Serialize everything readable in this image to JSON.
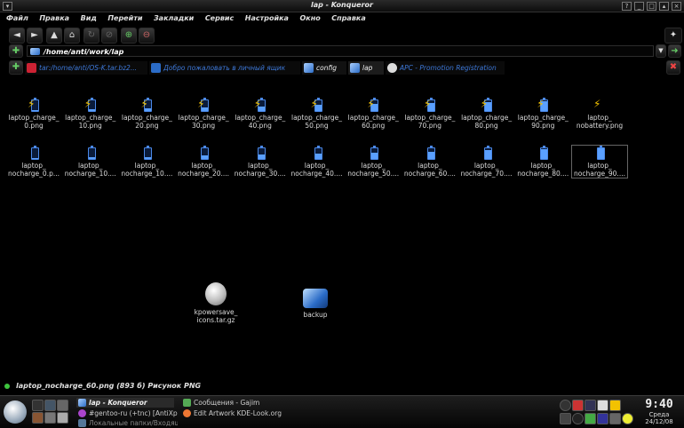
{
  "window": {
    "title": "lap - Konqueror"
  },
  "menubar": {
    "items": [
      "Файл",
      "Правка",
      "Вид",
      "Перейти",
      "Закладки",
      "Сервис",
      "Настройка",
      "Окно",
      "Справка"
    ]
  },
  "location": {
    "path": "/home/anti/work/lap"
  },
  "tabs": [
    {
      "label": "tar:/home/anti/OS-K.tar.bz2...",
      "state": "inactive"
    },
    {
      "label": "Добро пожаловать в личный ящик",
      "state": "inactive"
    },
    {
      "label": "config",
      "state": "active"
    },
    {
      "label": "lap",
      "state": "active"
    },
    {
      "label": "APC - Promotion Registration",
      "state": "inactive"
    }
  ],
  "files_row1": [
    {
      "l1": "laptop_charge_",
      "l2": "0.png",
      "level": 0.05
    },
    {
      "l1": "laptop_charge_",
      "l2": "10.png",
      "level": 0.15
    },
    {
      "l1": "laptop_charge_",
      "l2": "20.png",
      "level": 0.25
    },
    {
      "l1": "laptop_charge_",
      "l2": "30.png",
      "level": 0.35
    },
    {
      "l1": "laptop_charge_",
      "l2": "40.png",
      "level": 0.45
    },
    {
      "l1": "laptop_charge_",
      "l2": "50.png",
      "level": 0.55
    },
    {
      "l1": "laptop_charge_",
      "l2": "60.png",
      "level": 0.65
    },
    {
      "l1": "laptop_charge_",
      "l2": "70.png",
      "level": 0.75
    },
    {
      "l1": "laptop_charge_",
      "l2": "80.png",
      "level": 0.85
    },
    {
      "l1": "laptop_charge_",
      "l2": "90.png",
      "level": 0.95
    },
    {
      "l1": "laptop_",
      "l2": "nobattery.png",
      "level": 0
    }
  ],
  "files_row2": [
    {
      "l1": "laptop_",
      "l2": "nocharge_0.p...",
      "level": 0.05
    },
    {
      "l1": "laptop_",
      "l2": "nocharge_10....",
      "level": 0.15
    },
    {
      "l1": "laptop_",
      "l2": "nocharge_10....",
      "level": 0.2
    },
    {
      "l1": "laptop_",
      "l2": "nocharge_20....",
      "level": 0.3
    },
    {
      "l1": "laptop_",
      "l2": "nocharge_30....",
      "level": 0.4
    },
    {
      "l1": "laptop_",
      "l2": "nocharge_40....",
      "level": 0.5
    },
    {
      "l1": "laptop_",
      "l2": "nocharge_50....",
      "level": 0.6
    },
    {
      "l1": "laptop_",
      "l2": "nocharge_60....",
      "level": 0.7
    },
    {
      "l1": "laptop_",
      "l2": "nocharge_70....",
      "level": 0.8
    },
    {
      "l1": "laptop_",
      "l2": "nocharge_80....",
      "level": 0.9
    },
    {
      "l1": "laptop_",
      "l2": "nocharge_90....",
      "level": 1.0
    }
  ],
  "extra_files": [
    {
      "l1": "kpowersave_",
      "l2": "icons.tar.gz"
    },
    {
      "l1": "backup",
      "l2": ""
    }
  ],
  "status": {
    "text": "laptop_nocharge_60.png (893 б)  Рисунок PNG"
  },
  "taskbar": {
    "tasks": [
      {
        "label": "lap - Konqueror",
        "active": true
      },
      {
        "label": "Сообщения - Gajim",
        "active": false
      },
      {
        "label": "#gentoo-ru (+tnc) [AntiXpuc: !!!",
        "active": false
      },
      {
        "label": "Edit Artwork KDE-Look.org",
        "active": false
      },
      {
        "label": "Локальные папки/Входящи...",
        "active": false
      }
    ],
    "clock": {
      "time": "9:40",
      "weekday": "Среда",
      "date": "24/12/08"
    }
  },
  "colors": {
    "accent_blue": "#3d78d8",
    "bolt": "#f2c200",
    "battery": "#5aa0ff"
  }
}
